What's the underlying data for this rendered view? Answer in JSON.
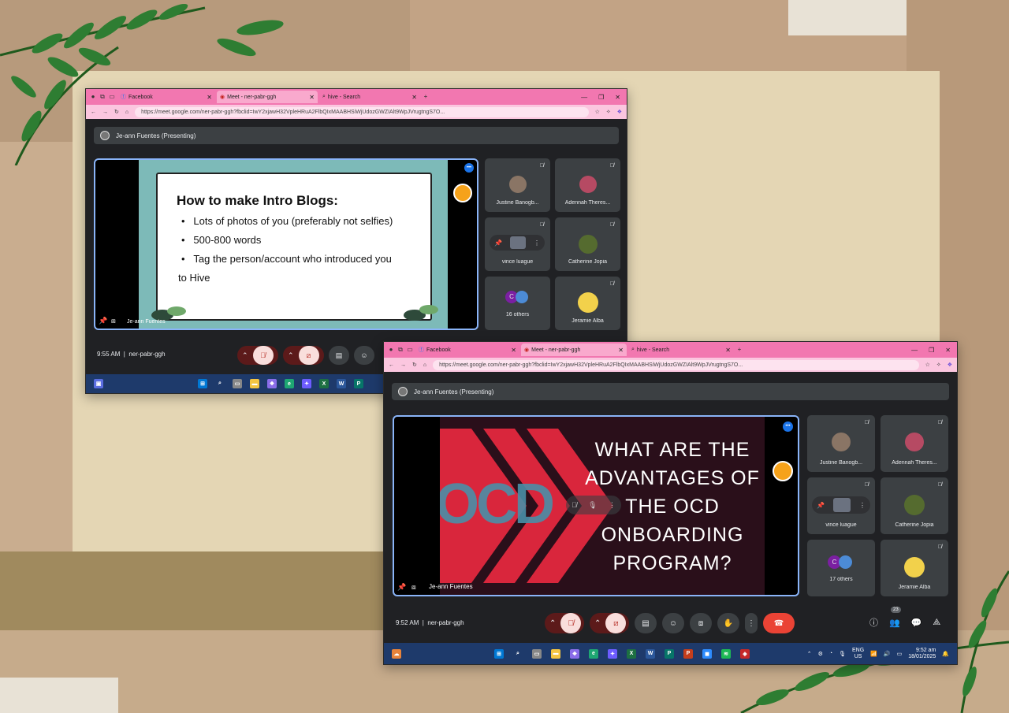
{
  "window1": {
    "tabs": [
      {
        "label": "Facebook"
      },
      {
        "label": "Meet - ner-pabr-ggh"
      },
      {
        "label": "hive - Search"
      }
    ],
    "url": "https://meet.google.com/ner-pabr-ggh?fbclid=IwY2xjawH32VpleHRuA2FlbQIxMAABHSiWjUdozGWZIAlt9WpJVrugtngS7O...",
    "presenter_label": "Je-ann Fuentes (Presenting)",
    "slide": {
      "title": "How to make Intro Blogs:",
      "bullets": [
        "Lots of photos of you (preferably not selfies)",
        "500-800 words",
        "Tag the person/account who introduced you"
      ],
      "continuation": "to Hive"
    },
    "stage_name": "Je-ann Fuentes",
    "participants": [
      {
        "name": "Justine Banogb..."
      },
      {
        "name": "Adennah Theres..."
      },
      {
        "name": "vince luague"
      },
      {
        "name": "Catherine Jopia"
      },
      {
        "name": "16 others",
        "avatar_letter": "C"
      },
      {
        "name": "Jeramie Alba"
      }
    ],
    "time": "9:55 AM",
    "meeting_code": "ner-pabr-ggh"
  },
  "window2": {
    "tabs": [
      {
        "label": "Facebook"
      },
      {
        "label": "Meet - ner-pabr-ggh"
      },
      {
        "label": "hive - Search"
      }
    ],
    "url": "https://meet.google.com/ner-pabr-ggh?fbclid=IwY2xjawH32VpleHRuA2FlbQIxMAABHSiWjUdozGWZIAlt9WpJVrugtngS7O...",
    "presenter_label": "Je-ann Fuentes (Presenting)",
    "slide": {
      "line1": "WHAT ARE THE",
      "line2": "ADVANTAGES OF",
      "line3": "THE OCD",
      "line4": "ONBOARDING",
      "line5": "PROGRAM?",
      "logo_text": "OCD"
    },
    "stage_name": "Je-ann Fuentes",
    "participants": [
      {
        "name": "Justine Banogb..."
      },
      {
        "name": "Adennah Theres..."
      },
      {
        "name": "vince luague"
      },
      {
        "name": "Catherine Jopia"
      },
      {
        "name": "17 others",
        "avatar_letter": "C"
      },
      {
        "name": "Jeramie Alba"
      }
    ],
    "time": "9:52 AM",
    "meeting_code": "ner-pabr-ggh",
    "people_count": "23",
    "tray": {
      "lang1": "ENG",
      "lang2": "US",
      "clock_time": "9:52 am",
      "clock_date": "18/01/2025"
    }
  },
  "colors": {
    "tab_pink": "#f277b0",
    "meet_bg": "#202124",
    "tile_bg": "#3c4043",
    "end_call": "#ea4335",
    "slide_teal": "#7dbab8",
    "slide2_bg": "#2a0f1a",
    "slide2_red": "#d9263c"
  }
}
